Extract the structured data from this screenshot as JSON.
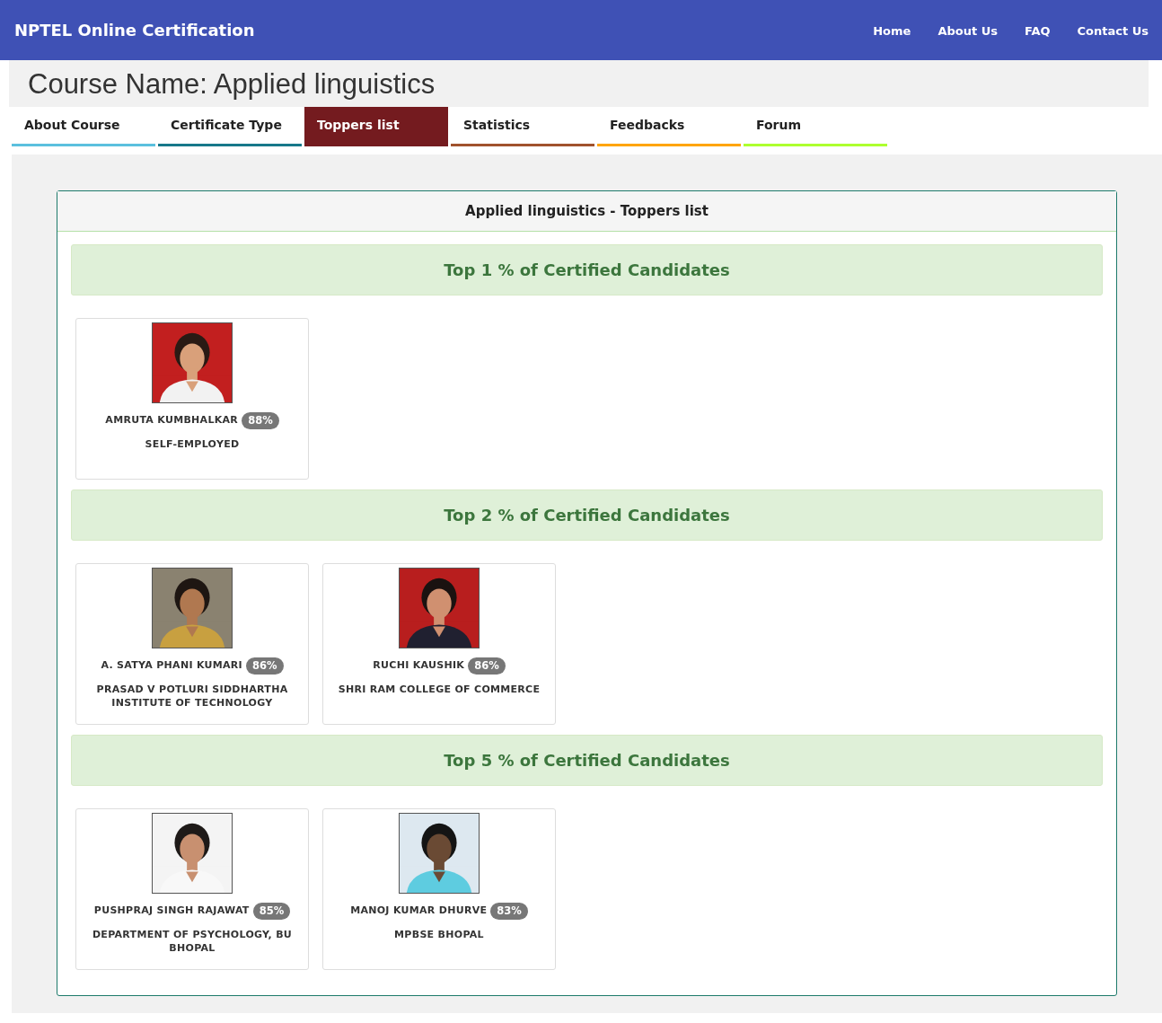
{
  "header": {
    "title": "NPTEL Online Certification",
    "nav": [
      "Home",
      "About Us",
      "FAQ",
      "Contact Us"
    ]
  },
  "course_title": "Course Name: Applied linguistics",
  "tabs": [
    {
      "label": "About Course",
      "selected": false,
      "color": "#5bc0de"
    },
    {
      "label": "Certificate Type",
      "selected": false,
      "color": "#17788a"
    },
    {
      "label": "Toppers list",
      "selected": true,
      "color": "#741b1f"
    },
    {
      "label": "Statistics",
      "selected": false,
      "color": "#a0522d"
    },
    {
      "label": "Feedbacks",
      "selected": false,
      "color": "#ffa500"
    },
    {
      "label": "Forum",
      "selected": false,
      "color": "#adff2f"
    }
  ],
  "panel": {
    "title": "Applied linguistics - Toppers list",
    "sections": [
      {
        "heading": "Top 1 % of Certified Candidates",
        "toppers": [
          {
            "name": "AMRUTA KUMBHALKAR",
            "score": "88%",
            "institution": "SELF-EMPLOYED"
          }
        ]
      },
      {
        "heading": "Top 2 % of Certified Candidates",
        "toppers": [
          {
            "name": "A. SATYA PHANI KUMARI",
            "score": "86%",
            "institution": "PRASAD V POTLURI SIDDHARTHA INSTITUTE OF TECHNOLOGY"
          },
          {
            "name": "RUCHI KAUSHIK",
            "score": "86%",
            "institution": "SHRI RAM COLLEGE OF COMMERCE"
          }
        ]
      },
      {
        "heading": "Top 5 % of Certified Candidates",
        "toppers": [
          {
            "name": "PUSHPRAJ SINGH RAJAWAT",
            "score": "85%",
            "institution": "DEPARTMENT OF PSYCHOLOGY, BU BHOPAL"
          },
          {
            "name": "MANOJ KUMAR DHURVE",
            "score": "83%",
            "institution": "MPBSE BHOPAL"
          }
        ]
      }
    ]
  }
}
